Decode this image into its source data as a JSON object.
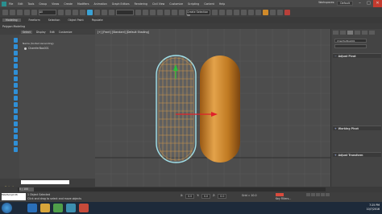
{
  "window": {
    "menu": [
      "File",
      "Edit",
      "Tools",
      "Group",
      "Views",
      "Create",
      "Modifiers",
      "Animation",
      "Graph Editors",
      "Rendering",
      "Civil View",
      "Customize",
      "Scripting",
      "Content",
      "Help"
    ],
    "workspace_label": "Workspaces:",
    "workspace_value": "Default"
  },
  "toolbar": {
    "filter_dropdown": "All",
    "named_selection": "Create Selection Se"
  },
  "ribbon": {
    "tabs": [
      "Modeling",
      "Freeform",
      "Selection",
      "Object Paint",
      "Populate"
    ],
    "active": "Modeling",
    "sub_label": "Polygon Modeling"
  },
  "scene_explorer": {
    "tabs": [
      "Select",
      "Display",
      "Edit",
      "Customize"
    ],
    "active_tab": "Select",
    "header": "Name (Sorted Ascending)",
    "items": [
      "ChamferBox001"
    ],
    "layer_label": "Default"
  },
  "viewport": {
    "label": "[+] [Front] [Standard] [Default Shading]",
    "colors": {
      "background": "#4d4d4d",
      "wire": "#d49a4a",
      "solid": "#d48b2c",
      "selection": "#9fe0ea",
      "x_axis": "#e0202a",
      "y_axis": "#2bbf3a"
    }
  },
  "command_panel": {
    "object_name": "ChamferBox001",
    "rollouts": [
      {
        "label": "Adjust Pivot"
      },
      {
        "label": "Working Pivot"
      },
      {
        "label": "Adjust Transform"
      }
    ]
  },
  "timeline": {
    "frame": "0 / 100"
  },
  "status": {
    "selection": "1 Object Selected",
    "hint": "Click and drag to select and move objects",
    "coords": [
      {
        "axis": "X:",
        "value": "0.0"
      },
      {
        "axis": "Y:",
        "value": "0.0"
      },
      {
        "axis": "Z:",
        "value": "0.0"
      }
    ],
    "grid": "Grid = 10.0",
    "autokey": "Auto Key",
    "selected_label": "Selected",
    "set_key": "Set Key",
    "key_filters": "Key Filters...",
    "maxscript": "MAXScript Mi"
  },
  "taskbar": {
    "time": "7:25 PM",
    "date": "10/7/2016"
  }
}
